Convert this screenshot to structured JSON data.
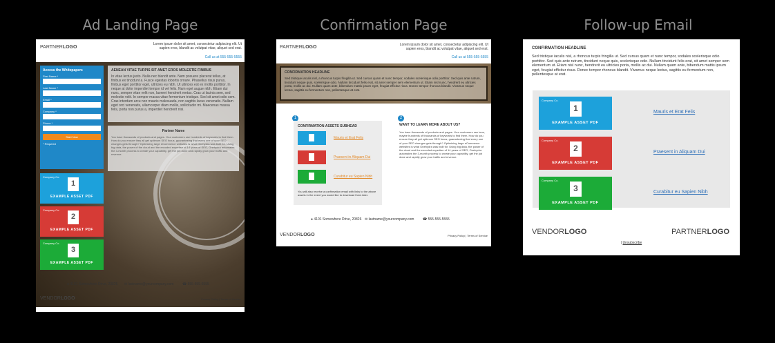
{
  "titles": {
    "landing": "Ad Landing Page",
    "confirmation": "Confirmation Page",
    "email": "Follow-up Email"
  },
  "logos": {
    "partner_a": "PARTNER",
    "partner_b": "LOGO",
    "vendor_a": "VENDOR",
    "vendor_b": "LOGO"
  },
  "header_tagline": "Lorem ipsum dolor sit amet, consectetur adipiscing elit. Ut sapien eros, blandit ac volutpat vitae, aliquet sed erat.",
  "header_call": "Call us at 555-555-5555",
  "landing": {
    "form_title": "Access the Whitepapers",
    "fields": [
      "First Name *",
      "Last Name *",
      "Email *",
      "Company *",
      "Phone *"
    ],
    "submit": "Start Now",
    "required_note": "* Required",
    "headline": "AENEAN VITAE TURPIS SIT AMET EROS MOLESTIE FINIBUS",
    "body": "In vitae lectus justo. Nulla nec blandit ante. Nam posuere placerat tellus, at finibus ex tincidunt a. Fusce egestas lobortis ornare. Phasellus risus purus, finibus eget porttitor eget, ultricies eu nibh. Ut ultricies est ex mollis porttitor. In neque at dolor imperdiet tempor id vel felis. Nam eget augue nibh. Etiam dui nunc, semper vitae velit non, laoreet hendrerit metus. Cras ut lacinia sem, sed molestie velit. In semper massa vitae fermentum tristique. Sed sit amet odio sem. Cras interdum arcu non mauris malesuada, non sagittis lacus venenatis. Nullam eget orci venenatis, ullamcorper diam mollis, sollicitudin mi. Maecenas massa felis, porta non purus a, imperdiet hendrerit nisi.",
    "partner_name": "Partner Name",
    "partner_text": "You have thousands of products and pages. Your customers use hundreds of keywords to find them. How do you ensure they all get optimum SEO focus, guaranteeing that every one of your SEO changes gets through? Optimizing large eCommerce websites is what Onehydra was built for. Using big data, the power of the cloud and the encoded expertise of 14 years of SEO, Onehydra automates the 3-month process to create your capability, get the job done and rapidly grow your traffic and revenue.",
    "footer_address": "4101 Somewhere Drive, 20826",
    "footer_email": "lastname@yourcompany.com",
    "footer_phone": "555-555-5555",
    "footer_links": "Privacy Policy | Terms of Service"
  },
  "assets": {
    "brand": "Company Co.",
    "caption": "EXAMPLE ASSET PDF",
    "numbers": [
      "1",
      "2",
      "3"
    ],
    "colors": [
      "#1da1db",
      "#d63b36",
      "#1cab38"
    ]
  },
  "confirmation": {
    "headline": "CONFIRMATION HEADLINE",
    "body": "Sed tristique iaculis nisl, a rhoncus turpis fringilla ut. Sed cursus quam et nunc tempor, sodales scelerisque odio porttitor. Sed quis ante rutrum, tincidunt neque quis, scelerisque odio. Nullam tincidunt felis erat, sit amet semper sem elementum ut. Etiam nisl nunc, hendrerit eu ultricies porta, mollis ac dui. Nullam quam ante, bibendum mattis ipsum eget, feugiat efficitur risus. Donec tempor rhoncus blandit. Vivamus neque lectus, sagittis eu fermentum non, pellentesque at erat.",
    "step1": "1",
    "step2": "2",
    "assets_subhead": "CONFIRMATION ASSETS SUBHEAD",
    "links": [
      "Mauris et Erat Felis",
      "Praesent in Aliquam Dui",
      "Curabitur eu Sapien Nibh"
    ],
    "assets_note": "You will also receive a confirmation email with links to the above assets in the event you would like to download them later.",
    "learn_title": "WANT TO LEARN MORE ABOUT US?",
    "learn_text": "You have thousands of products and pages. Your customers use tens, maybe hundreds of thousands of keywords to find them. How do you ensure they all get optimum SEO focus, guaranteeing that every one of your SEO changes gets through? Optimizing large eCommerce websites is what Onehydra was built for. Using big data, the power of the cloud and the encoded expertise of 14 years of SEO, Onehydra automates the 3-month process to create your capability, get the job done and rapidly grow your traffic and revenue.",
    "footer_links": "Privacy Policy | Terms of Service"
  },
  "email": {
    "headline": "CONFIRMATION HEADLINE",
    "body": "Sed tristique iaculis nisl, a rhoncus turpis fringilla ut. Sed cursus quam et nunc tempor, sodales scelerisque odio porttitor. Sed quis ante rutrum, tincidunt neque quis, scelerisque odio. Nullam tincidunt felis erat, sit amet semper sem elementum ut. Etiam nisl nunc, hendrerit eu ultricies porta, mollis ac dui. Nullam quam ante, bibendum mattis ipsum eget, feugiat efficitur risus. Donec tempor rhoncus blandit. Vivamus neque lectus, sagittis eu fermentum non, pellentesque at erat.",
    "links": [
      "Mauris et Erat Felis",
      "Praesent in Aliquam Dui",
      "Curabitur eu Sapien Nibh"
    ],
    "unsubscribe": "Unsubscribe"
  }
}
